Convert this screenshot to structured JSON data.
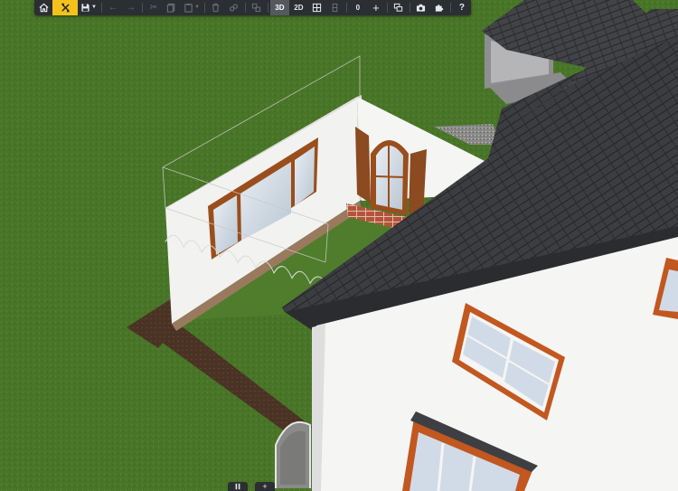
{
  "toolbar": {
    "home_icon": "home-icon",
    "tools_icon": "tools-icon",
    "save_icon": "floppy-disk-icon",
    "undo_icon": "arrow-left-icon",
    "redo_icon": "arrow-right-icon",
    "cut_icon": "scissors-icon",
    "copy_icon": "copy-icon",
    "paste_icon": "paste-icon",
    "delete_icon": "trash-icon",
    "link_icon": "link-icon",
    "group_icon": "group-icon",
    "mode_3d_label": "3D",
    "mode_2d_label": "2D",
    "grid_icon": "grid-icon",
    "level_icon": "level-icon",
    "counter_value": "0",
    "add_icon": "plus-icon",
    "layers_icon": "layers-icon",
    "camera_icon": "camera-icon",
    "plugin_icon": "puzzle-icon",
    "help_label": "?",
    "accent_color": "#f4c21c",
    "background_color": "#2b2e33"
  },
  "bottom_controls": {
    "pause_icon": "pause-icon",
    "add_icon": "plus-icon"
  }
}
